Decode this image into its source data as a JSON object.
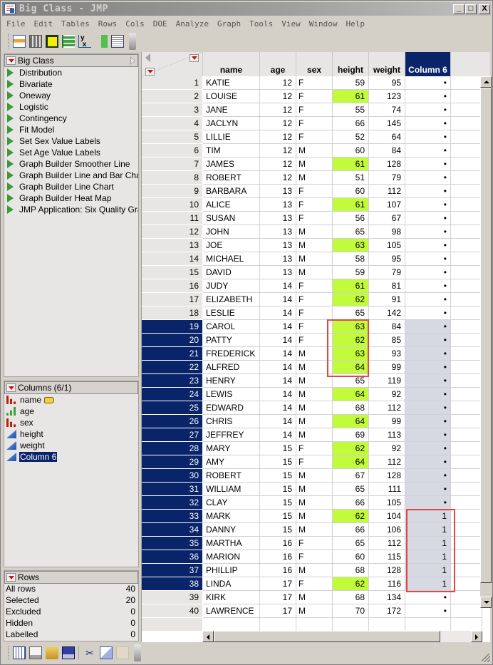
{
  "window": {
    "title": "Big Class - JMP",
    "controls": {
      "minimize": "_",
      "maximize": "□",
      "close": "X"
    }
  },
  "menu": [
    "File",
    "Edit",
    "Tables",
    "Rows",
    "Cols",
    "DOE",
    "Analyze",
    "Graph",
    "Tools",
    "View",
    "Window",
    "Help"
  ],
  "toolbar": {
    "icons": [
      "new-data-table-icon",
      "calculator-icon",
      "distribution-grid-icon",
      "oneway-bars-icon",
      "fit-y-by-x-icon",
      "fit-model-icon",
      "script-editor-icon"
    ]
  },
  "table_panel": {
    "title": "Big Class",
    "scripts": [
      "Distribution",
      "Bivariate",
      "Oneway",
      "Logistic",
      "Contingency",
      "Fit Model",
      "Set Sex Value Labels",
      "Set Age Value Labels",
      "Graph Builder Smoother Line",
      "Graph Builder Line and Bar Chart",
      "Graph Builder Line Chart",
      "Graph Builder Heat Map",
      "JMP Application: Six Quality Gra"
    ]
  },
  "columns_panel": {
    "title": "Columns (6/1)",
    "columns": [
      {
        "name": "name",
        "type": "nominal",
        "label_tag": true,
        "selected": false
      },
      {
        "name": "age",
        "type": "ordinal",
        "label_tag": false,
        "selected": false
      },
      {
        "name": "sex",
        "type": "nominal",
        "label_tag": false,
        "selected": false
      },
      {
        "name": "height",
        "type": "continuous",
        "label_tag": false,
        "selected": false
      },
      {
        "name": "weight",
        "type": "continuous",
        "label_tag": false,
        "selected": false
      },
      {
        "name": "Column 6",
        "type": "continuous",
        "label_tag": false,
        "selected": true
      }
    ]
  },
  "rows_panel": {
    "title": "Rows",
    "stats": [
      {
        "label": "All rows",
        "value": "40"
      },
      {
        "label": "Selected",
        "value": "20"
      },
      {
        "label": "Excluded",
        "value": "0"
      },
      {
        "label": "Hidden",
        "value": "0"
      },
      {
        "label": "Labelled",
        "value": "0"
      }
    ]
  },
  "grid": {
    "headers": [
      "name",
      "age",
      "sex",
      "height",
      "weight",
      "Column 6"
    ],
    "selected_column": "Column 6",
    "highlight_color": "#c2fa3c",
    "selection_color": "#0a246a",
    "rows": [
      {
        "n": "1",
        "name": "KATIE",
        "age": "12",
        "sex": "F",
        "height": "59",
        "weight": "95",
        "c6": "•",
        "sel": false,
        "hl": false
      },
      {
        "n": "2",
        "name": "LOUISE",
        "age": "12",
        "sex": "F",
        "height": "61",
        "weight": "123",
        "c6": "•",
        "sel": false,
        "hl": true
      },
      {
        "n": "3",
        "name": "JANE",
        "age": "12",
        "sex": "F",
        "height": "55",
        "weight": "74",
        "c6": "•",
        "sel": false,
        "hl": false
      },
      {
        "n": "4",
        "name": "JACLYN",
        "age": "12",
        "sex": "F",
        "height": "66",
        "weight": "145",
        "c6": "•",
        "sel": false,
        "hl": false
      },
      {
        "n": "5",
        "name": "LILLIE",
        "age": "12",
        "sex": "F",
        "height": "52",
        "weight": "64",
        "c6": "•",
        "sel": false,
        "hl": false
      },
      {
        "n": "6",
        "name": "TIM",
        "age": "12",
        "sex": "M",
        "height": "60",
        "weight": "84",
        "c6": "•",
        "sel": false,
        "hl": false
      },
      {
        "n": "7",
        "name": "JAMES",
        "age": "12",
        "sex": "M",
        "height": "61",
        "weight": "128",
        "c6": "•",
        "sel": false,
        "hl": true
      },
      {
        "n": "8",
        "name": "ROBERT",
        "age": "12",
        "sex": "M",
        "height": "51",
        "weight": "79",
        "c6": "•",
        "sel": false,
        "hl": false
      },
      {
        "n": "9",
        "name": "BARBARA",
        "age": "13",
        "sex": "F",
        "height": "60",
        "weight": "112",
        "c6": "•",
        "sel": false,
        "hl": false
      },
      {
        "n": "10",
        "name": "ALICE",
        "age": "13",
        "sex": "F",
        "height": "61",
        "weight": "107",
        "c6": "•",
        "sel": false,
        "hl": true
      },
      {
        "n": "11",
        "name": "SUSAN",
        "age": "13",
        "sex": "F",
        "height": "56",
        "weight": "67",
        "c6": "•",
        "sel": false,
        "hl": false
      },
      {
        "n": "12",
        "name": "JOHN",
        "age": "13",
        "sex": "M",
        "height": "65",
        "weight": "98",
        "c6": "•",
        "sel": false,
        "hl": false
      },
      {
        "n": "13",
        "name": "JOE",
        "age": "13",
        "sex": "M",
        "height": "63",
        "weight": "105",
        "c6": "•",
        "sel": false,
        "hl": true
      },
      {
        "n": "14",
        "name": "MICHAEL",
        "age": "13",
        "sex": "M",
        "height": "58",
        "weight": "95",
        "c6": "•",
        "sel": false,
        "hl": false
      },
      {
        "n": "15",
        "name": "DAVID",
        "age": "13",
        "sex": "M",
        "height": "59",
        "weight": "79",
        "c6": "•",
        "sel": false,
        "hl": false
      },
      {
        "n": "16",
        "name": "JUDY",
        "age": "14",
        "sex": "F",
        "height": "61",
        "weight": "81",
        "c6": "•",
        "sel": false,
        "hl": true
      },
      {
        "n": "17",
        "name": "ELIZABETH",
        "age": "14",
        "sex": "F",
        "height": "62",
        "weight": "91",
        "c6": "•",
        "sel": false,
        "hl": true
      },
      {
        "n": "18",
        "name": "LESLIE",
        "age": "14",
        "sex": "F",
        "height": "65",
        "weight": "142",
        "c6": "•",
        "sel": false,
        "hl": false
      },
      {
        "n": "19",
        "name": "CAROL",
        "age": "14",
        "sex": "F",
        "height": "63",
        "weight": "84",
        "c6": "•",
        "sel": true,
        "hl": true
      },
      {
        "n": "20",
        "name": "PATTY",
        "age": "14",
        "sex": "F",
        "height": "62",
        "weight": "85",
        "c6": "•",
        "sel": true,
        "hl": true
      },
      {
        "n": "21",
        "name": "FREDERICK",
        "age": "14",
        "sex": "M",
        "height": "63",
        "weight": "93",
        "c6": "•",
        "sel": true,
        "hl": true
      },
      {
        "n": "22",
        "name": "ALFRED",
        "age": "14",
        "sex": "M",
        "height": "64",
        "weight": "99",
        "c6": "•",
        "sel": true,
        "hl": true
      },
      {
        "n": "23",
        "name": "HENRY",
        "age": "14",
        "sex": "M",
        "height": "65",
        "weight": "119",
        "c6": "•",
        "sel": true,
        "hl": false
      },
      {
        "n": "24",
        "name": "LEWIS",
        "age": "14",
        "sex": "M",
        "height": "64",
        "weight": "92",
        "c6": "•",
        "sel": true,
        "hl": true
      },
      {
        "n": "25",
        "name": "EDWARD",
        "age": "14",
        "sex": "M",
        "height": "68",
        "weight": "112",
        "c6": "•",
        "sel": true,
        "hl": false
      },
      {
        "n": "26",
        "name": "CHRIS",
        "age": "14",
        "sex": "M",
        "height": "64",
        "weight": "99",
        "c6": "•",
        "sel": true,
        "hl": true
      },
      {
        "n": "27",
        "name": "JEFFREY",
        "age": "14",
        "sex": "M",
        "height": "69",
        "weight": "113",
        "c6": "•",
        "sel": true,
        "hl": false
      },
      {
        "n": "28",
        "name": "MARY",
        "age": "15",
        "sex": "F",
        "height": "62",
        "weight": "92",
        "c6": "•",
        "sel": true,
        "hl": true
      },
      {
        "n": "29",
        "name": "AMY",
        "age": "15",
        "sex": "F",
        "height": "64",
        "weight": "112",
        "c6": "•",
        "sel": true,
        "hl": true
      },
      {
        "n": "30",
        "name": "ROBERT",
        "age": "15",
        "sex": "M",
        "height": "67",
        "weight": "128",
        "c6": "•",
        "sel": true,
        "hl": false
      },
      {
        "n": "31",
        "name": "WILLIAM",
        "age": "15",
        "sex": "M",
        "height": "65",
        "weight": "111",
        "c6": "•",
        "sel": true,
        "hl": false
      },
      {
        "n": "32",
        "name": "CLAY",
        "age": "15",
        "sex": "M",
        "height": "66",
        "weight": "105",
        "c6": "•",
        "sel": true,
        "hl": false
      },
      {
        "n": "33",
        "name": "MARK",
        "age": "15",
        "sex": "M",
        "height": "62",
        "weight": "104",
        "c6": "1",
        "sel": true,
        "hl": true
      },
      {
        "n": "34",
        "name": "DANNY",
        "age": "15",
        "sex": "M",
        "height": "66",
        "weight": "106",
        "c6": "1",
        "sel": true,
        "hl": false
      },
      {
        "n": "35",
        "name": "MARTHA",
        "age": "16",
        "sex": "F",
        "height": "65",
        "weight": "112",
        "c6": "1",
        "sel": true,
        "hl": false
      },
      {
        "n": "36",
        "name": "MARION",
        "age": "16",
        "sex": "F",
        "height": "60",
        "weight": "115",
        "c6": "1",
        "sel": true,
        "hl": false
      },
      {
        "n": "37",
        "name": "PHILLIP",
        "age": "16",
        "sex": "M",
        "height": "68",
        "weight": "128",
        "c6": "1",
        "sel": true,
        "hl": false
      },
      {
        "n": "38",
        "name": "LINDA",
        "age": "17",
        "sex": "F",
        "height": "62",
        "weight": "116",
        "c6": "1",
        "sel": true,
        "hl": true
      },
      {
        "n": "39",
        "name": "KIRK",
        "age": "17",
        "sex": "M",
        "height": "68",
        "weight": "134",
        "c6": "•",
        "sel": false,
        "hl": false
      },
      {
        "n": "40",
        "name": "LAWRENCE",
        "age": "17",
        "sex": "M",
        "height": "70",
        "weight": "172",
        "c6": "•",
        "sel": false,
        "hl": false
      }
    ]
  },
  "annotations": [
    {
      "name": "height-rows-19-22-box",
      "column": "height",
      "rows": [
        "19",
        "22"
      ],
      "color": "#e04848"
    },
    {
      "name": "column6-rows-33-38-box",
      "column": "Column 6",
      "rows": [
        "33",
        "38"
      ],
      "color": "#e04848"
    }
  ],
  "bottom_toolbar": {
    "icons": [
      "new-table-icon",
      "new-script-icon",
      "open-folder-icon",
      "save-icon",
      "cut-icon",
      "copy-icon",
      "paste-icon"
    ]
  }
}
